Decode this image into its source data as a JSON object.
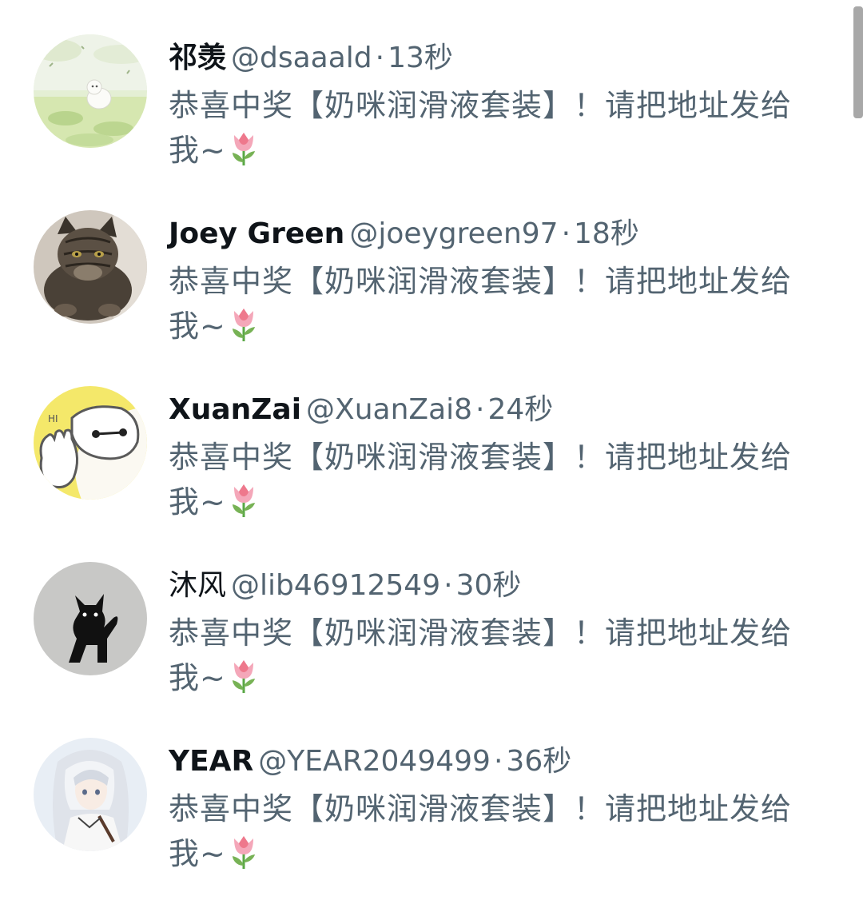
{
  "replies": [
    {
      "name": "祁羡",
      "handle": "@dsaaald",
      "time": "13秒",
      "text": "恭喜中奖【奶咪润滑液套装】！请把地址发给我~",
      "avatar_icon": "puppy-on-grass-avatar"
    },
    {
      "name": "Joey Green",
      "handle": "@joeygreen97",
      "time": "18秒",
      "text": "恭喜中奖【奶咪润滑液套装】！请把地址发给我~",
      "avatar_icon": "tabby-cat-avatar"
    },
    {
      "name": "XuanZai",
      "handle": "@XuanZai8",
      "time": "24秒",
      "text": "恭喜中奖【奶咪润滑液套装】！请把地址发给我~",
      "avatar_icon": "baymax-waving-avatar"
    },
    {
      "name": "沐风",
      "handle": "@lib46912549",
      "time": "30秒",
      "text": "恭喜中奖【奶咪润滑液套装】！请把地址发给我~",
      "avatar_icon": "black-cat-avatar"
    },
    {
      "name": "YEAR",
      "handle": "@YEAR2049499",
      "time": "36秒",
      "text": "恭喜中奖【奶咪润滑液套装】！请把地址发给我~",
      "avatar_icon": "anime-girl-avatar"
    }
  ],
  "separator": "·",
  "emoji_icon": "tulip-emoji",
  "colors": {
    "name": "#0f1419",
    "secondary": "#536471",
    "background": "#ffffff"
  }
}
